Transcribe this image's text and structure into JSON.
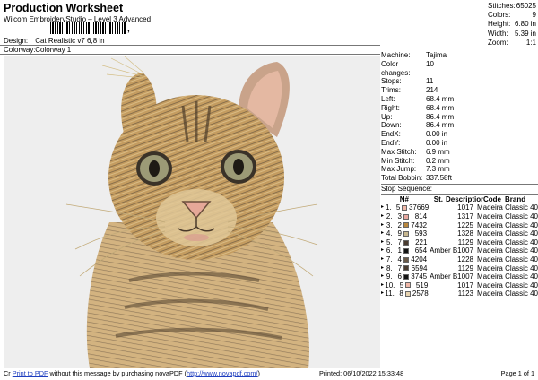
{
  "header": {
    "title": "Production Worksheet",
    "subtitle": "Wilcom EmbroideryStudio – Level 3 Advanced",
    "barcode_sep": ","
  },
  "meta": {
    "design_label": "Design:",
    "design_value": "Cat Realistic v7 6,8 in",
    "colorway_label": "Colorway:",
    "colorway_value": "Colorway 1"
  },
  "stats": [
    {
      "k": "Stitches:",
      "v": "65025"
    },
    {
      "k": "Colors:",
      "v": "9"
    },
    {
      "k": "Height:",
      "v": "6.80 in"
    },
    {
      "k": "Width:",
      "v": "5.39 in"
    },
    {
      "k": "Zoom:",
      "v": "1:1"
    }
  ],
  "machine": [
    {
      "k": "Machine:",
      "v": "Tajima"
    },
    {
      "k": "Color changes:",
      "v": "10"
    },
    {
      "k": "Stops:",
      "v": "11"
    },
    {
      "k": "Trims:",
      "v": "214"
    },
    {
      "k": "Left:",
      "v": "68.4 mm"
    },
    {
      "k": "Right:",
      "v": "68.4 mm"
    },
    {
      "k": "Up:",
      "v": "86.4 mm"
    },
    {
      "k": "Down:",
      "v": "86.4 mm"
    },
    {
      "k": "EndX:",
      "v": "0.00 in"
    },
    {
      "k": "EndY:",
      "v": "0.00 in"
    },
    {
      "k": "Max Stitch:",
      "v": "6.9 mm"
    },
    {
      "k": "Min Stitch:",
      "v": "0.2 mm"
    },
    {
      "k": "Max Jump:",
      "v": "7.3 mm"
    },
    {
      "k": "Total Bobbin:",
      "v": "337.58ft"
    }
  ],
  "stop_sequence": {
    "label": "Stop Sequence:",
    "headers": {
      "n": "N#",
      "st": "St.",
      "desc": "Description",
      "code": "Code",
      "brand": "Brand"
    },
    "rows": [
      {
        "idx": "1.",
        "n": "5",
        "color": "#f0b8a8",
        "st": "37669",
        "desc": "",
        "code": "1017",
        "brand": "Madeira Classic 40"
      },
      {
        "idx": "2.",
        "n": "3",
        "color": "#e8a8a0",
        "st": "814",
        "desc": "",
        "code": "1317",
        "brand": "Madeira Classic 40"
      },
      {
        "idx": "3.",
        "n": "2",
        "color": "#b8863c",
        "st": "7432",
        "desc": "",
        "code": "1225",
        "brand": "Madeira Classic 40"
      },
      {
        "idx": "4.",
        "n": "9",
        "color": "#c8b890",
        "st": "593",
        "desc": "",
        "code": "1328",
        "brand": "Madeira Classic 40"
      },
      {
        "idx": "5.",
        "n": "7",
        "color": "#4a3c30",
        "st": "221",
        "desc": "",
        "code": "1129",
        "brand": "Madeira Classic 40"
      },
      {
        "idx": "6.",
        "n": "1",
        "color": "#141414",
        "st": "654",
        "desc": "Amber Black",
        "code": "1007",
        "brand": "Madeira Classic 40"
      },
      {
        "idx": "7.",
        "n": "4",
        "color": "#6a5a48",
        "st": "4204",
        "desc": "",
        "code": "1228",
        "brand": "Madeira Classic 40"
      },
      {
        "idx": "8.",
        "n": "7",
        "color": "#4a3c30",
        "st": "6594",
        "desc": "",
        "code": "1129",
        "brand": "Madeira Classic 40"
      },
      {
        "idx": "9.",
        "n": "6",
        "color": "#141414",
        "st": "3745",
        "desc": "Amber Black",
        "code": "1007",
        "brand": "Madeira Classic 40"
      },
      {
        "idx": "10.",
        "n": "5",
        "color": "#f0b8a8",
        "st": "519",
        "desc": "",
        "code": "1017",
        "brand": "Madeira Classic 40"
      },
      {
        "idx": "11.",
        "n": "8",
        "color": "#e8d4b0",
        "st": "2578",
        "desc": "",
        "code": "1123",
        "brand": "Madeira Classic 40"
      }
    ]
  },
  "footer": {
    "prefix": "Cr",
    "link": "Print to PDF",
    "middle": " without this message by purchasing novaPDF (",
    "url": "http://www.novapdf.com/",
    "suffix": ")",
    "printed": "Printed: 06/10/2022 15:33:48",
    "page": "Page 1 of 1"
  },
  "colors": {
    "canvas": "#eeeeee",
    "fur_light": "#c9a46a",
    "fur_dark": "#6b5a40",
    "ear_pink": "#e8b8a0"
  }
}
